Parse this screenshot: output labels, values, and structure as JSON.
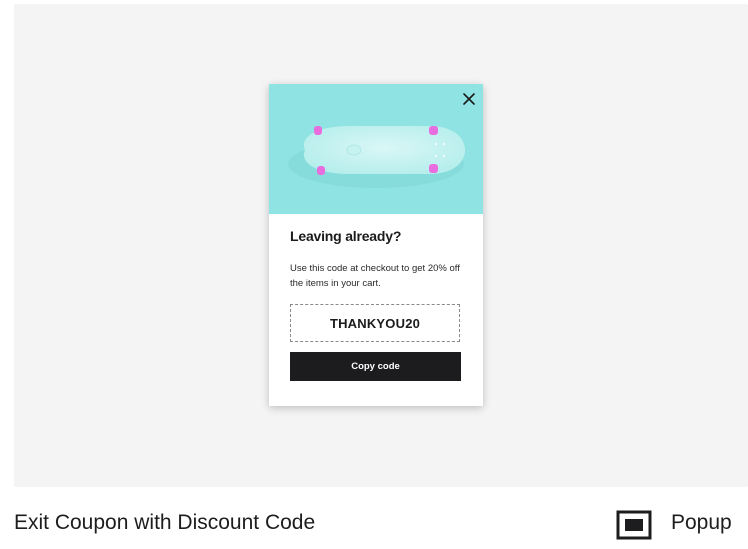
{
  "template_preview": {
    "popup": {
      "title": "Leaving already?",
      "body": "Use this code at checkout to get 20% off the items in your cart.",
      "coupon_code": "THANKYOU20",
      "copy_button_label": "Copy code",
      "image_icon": "skateboard-image",
      "close_icon": "close-icon"
    }
  },
  "footer": {
    "template_name": "Exit Coupon with Discount Code",
    "template_type_label": "Popup",
    "template_type_icon": "popup-window-icon"
  },
  "colors": {
    "stage_background": "#f4f4f4",
    "hero_background": "#8fe3e2",
    "button_background": "#1c1c1e",
    "wheel_color": "#e86ee0"
  }
}
